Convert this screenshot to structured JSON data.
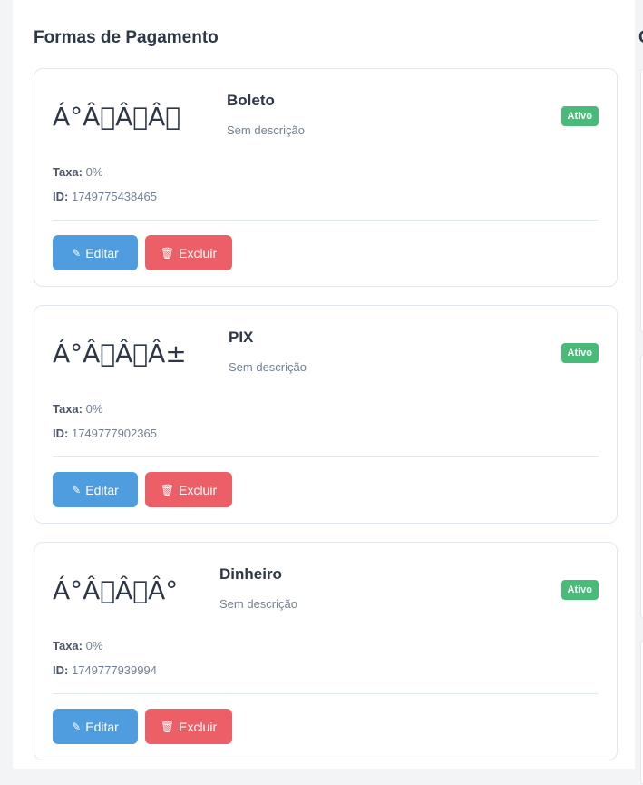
{
  "section": {
    "title": "Formas de Pagamento",
    "next_title": "C"
  },
  "labels": {
    "fee": "Taxa:",
    "id": "ID:",
    "edit": "Editar",
    "delete": "Excluir"
  },
  "icons": {
    "edit": "pencil-icon",
    "delete": "trash-icon"
  },
  "colors": {
    "active": "#48bb78",
    "edit": "#4f9ddf",
    "delete": "#ec5f67"
  },
  "methods": [
    {
      "icon_text": "Á°Â\u0000Â\u0000Â\u0000",
      "name": "Boleto",
      "description": "Sem descrição",
      "status": "Ativo",
      "fee": "0%",
      "id": "1749775438465"
    },
    {
      "icon_text": "Á°Â\u0000Â\u0000Â±",
      "name": "PIX",
      "description": "Sem descrição",
      "status": "Ativo",
      "fee": "0%",
      "id": "1749777902365"
    },
    {
      "icon_text": "Á°Â\u0000Â\u0000Â°",
      "name": "Dinheiro",
      "description": "Sem descrição",
      "status": "Ativo",
      "fee": "0%",
      "id": "1749777939994"
    }
  ]
}
